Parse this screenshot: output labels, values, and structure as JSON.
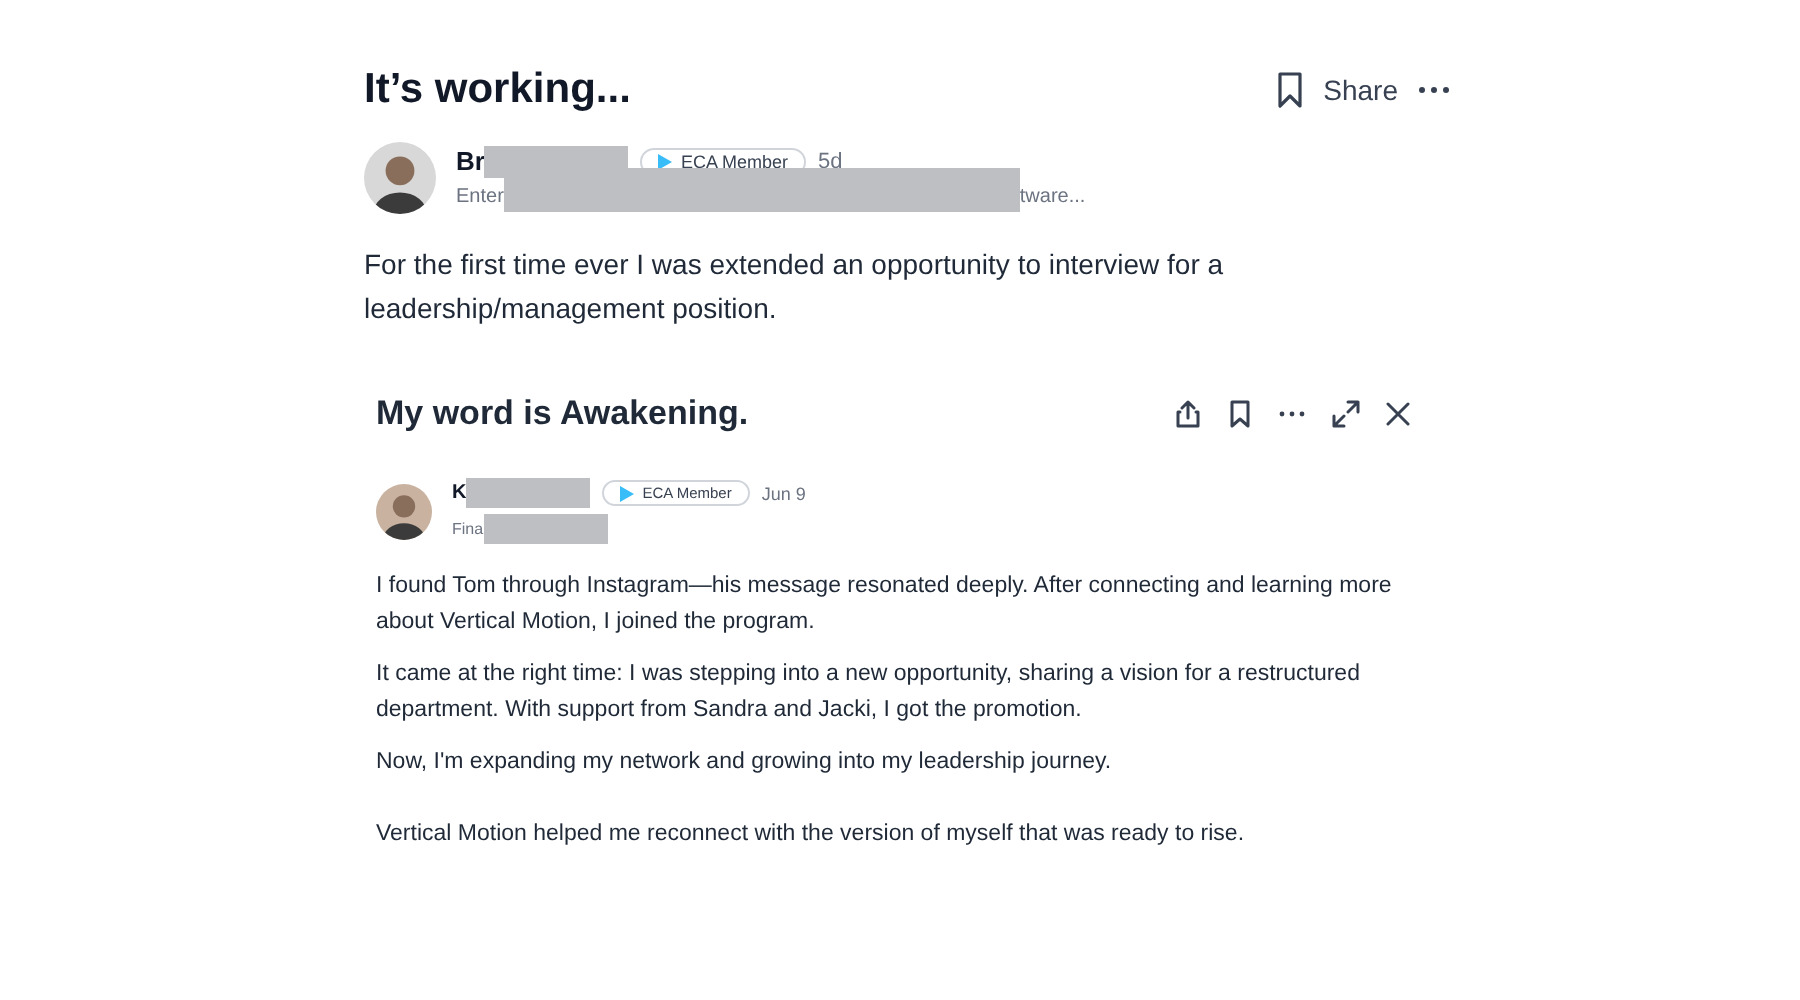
{
  "post": {
    "title": "It’s working...",
    "actions": {
      "share": "Share"
    },
    "author": {
      "name_visible": "Br",
      "badge": "ECA Member",
      "time": "5d",
      "headline_start": "Enter",
      "headline_end": "tware..."
    },
    "body": "For the first time ever I was extended an opportunity to interview for a leadership/management position."
  },
  "card": {
    "title": "My word is Awakening.",
    "author": {
      "name_visible": "K",
      "badge": "ECA Member",
      "time": "Jun 9",
      "headline_start": "Fina"
    },
    "paragraphs": [
      "I found Tom through Instagram—his message resonated deeply. After connecting and learning more about Vertical Motion, I joined the program.",
      "It came at the right time: I was stepping into a new opportunity, sharing a vision for a restructured department. With support from Sandra and Jacki, I got the promotion.",
      "Now, I'm expanding my network and growing into my leadership journey.",
      "Vertical Motion helped me reconnect with the version of myself that was ready to rise."
    ]
  }
}
